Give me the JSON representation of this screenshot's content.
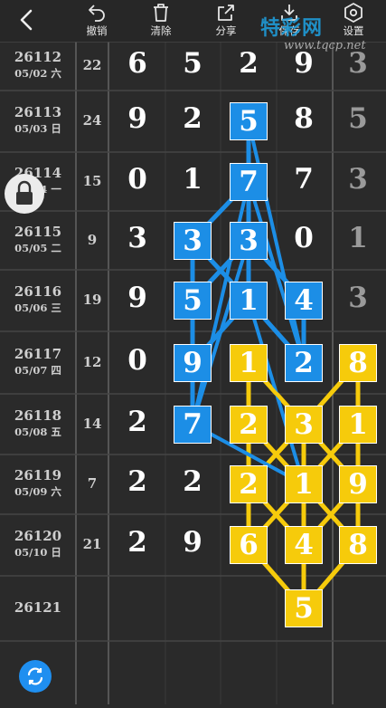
{
  "toolbar": {
    "back_icon": "chevron-left-icon",
    "items": [
      {
        "label": "撤销",
        "icon": "undo-icon"
      },
      {
        "label": "清除",
        "icon": "trash-icon"
      },
      {
        "label": "分享",
        "icon": "share-icon"
      },
      {
        "label": "保存",
        "icon": "download-icon"
      },
      {
        "label": "设置",
        "icon": "settings-hexagon-icon"
      }
    ]
  },
  "watermark": {
    "title": "特彩网",
    "url": "www.tqcp.net"
  },
  "rows": [
    {
      "issue": "26112",
      "date": "05/02 六",
      "sum": "22",
      "digits": [
        "6",
        "5",
        "2",
        "9",
        "3"
      ]
    },
    {
      "issue": "26113",
      "date": "05/03 日",
      "sum": "24",
      "digits": [
        "9",
        "2",
        "5",
        "8",
        "5"
      ]
    },
    {
      "issue": "26114",
      "date": "05/04 一",
      "sum": "15",
      "digits": [
        "0",
        "1",
        "7",
        "7",
        "3"
      ]
    },
    {
      "issue": "26115",
      "date": "05/05 二",
      "sum": "9",
      "digits": [
        "3",
        "3",
        "3",
        "0",
        "1"
      ]
    },
    {
      "issue": "26116",
      "date": "05/06 三",
      "sum": "19",
      "digits": [
        "9",
        "5",
        "1",
        "4",
        "3"
      ]
    },
    {
      "issue": "26117",
      "date": "05/07 四",
      "sum": "12",
      "digits": [
        "0",
        "9",
        "1",
        "2",
        "8"
      ]
    },
    {
      "issue": "26118",
      "date": "05/08 五",
      "sum": "14",
      "digits": [
        "2",
        "7",
        "2",
        "3",
        "1"
      ]
    },
    {
      "issue": "26119",
      "date": "05/09 六",
      "sum": "7",
      "digits": [
        "2",
        "2",
        "2",
        "1",
        "9"
      ]
    },
    {
      "issue": "26120",
      "date": "05/10 日",
      "sum": "21",
      "digits": [
        "2",
        "9",
        "6",
        "4",
        "8"
      ]
    },
    {
      "issue": "26121",
      "date": "",
      "sum": "",
      "digits": [
        "",
        "",
        "",
        "5",
        ""
      ]
    }
  ],
  "colors": {
    "blue": "#1c8ee6",
    "yellow": "#f6cb0b",
    "background": "#2a2a2a"
  },
  "highlights": {
    "blue": [
      [
        1,
        2
      ],
      [
        2,
        2
      ],
      [
        3,
        1
      ],
      [
        3,
        2
      ],
      [
        4,
        1
      ],
      [
        4,
        2
      ],
      [
        4,
        3
      ],
      [
        5,
        1
      ],
      [
        5,
        3
      ],
      [
        6,
        1
      ]
    ],
    "yellow": [
      [
        5,
        2
      ],
      [
        5,
        4
      ],
      [
        6,
        2
      ],
      [
        6,
        3
      ],
      [
        6,
        4
      ],
      [
        7,
        2
      ],
      [
        7,
        3
      ],
      [
        7,
        4
      ],
      [
        8,
        2
      ],
      [
        8,
        3
      ],
      [
        8,
        4
      ],
      [
        9,
        3
      ]
    ]
  },
  "lock_icon": "lock-icon",
  "refresh_icon": "refresh-icon"
}
